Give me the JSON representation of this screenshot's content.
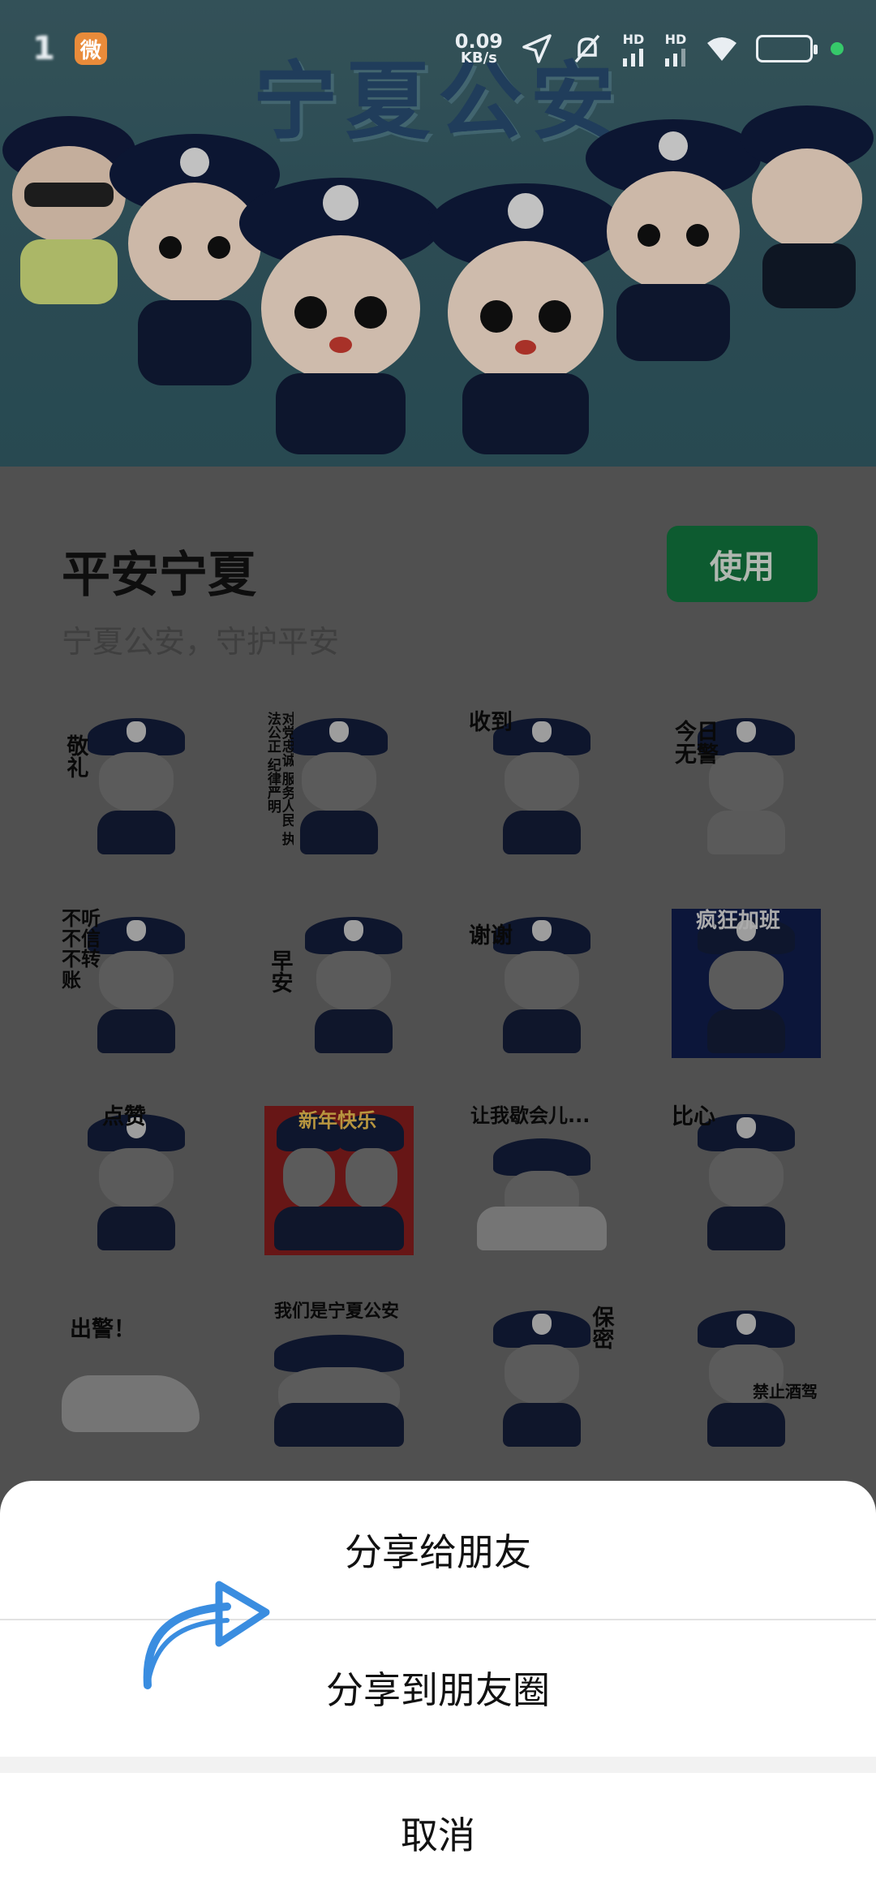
{
  "status_bar": {
    "time": "1",
    "net_speed_value": "0.09",
    "net_speed_unit": "KB/s",
    "hd1": "HD",
    "hd2": "HD",
    "app_notif_icon": "weibo-icon"
  },
  "banner": {
    "title": "宁夏公安",
    "colors": {
      "background": "#355a63",
      "title": "#26486b"
    }
  },
  "pack": {
    "title": "平安宁夏",
    "subtitle": "宁夏公安，守护平安",
    "use_button": "使用",
    "accent": "#106c39",
    "stickers": [
      {
        "caption": "敬礼"
      },
      {
        "caption": "对党忠诚 服务人民 执法公正 纪律严明"
      },
      {
        "caption": "收到"
      },
      {
        "caption": "今日无警"
      },
      {
        "caption": "不听 不信 不转账"
      },
      {
        "caption": "早安"
      },
      {
        "caption": "谢谢"
      },
      {
        "caption": "疯狂加班"
      },
      {
        "caption": "点赞"
      },
      {
        "caption": "新年快乐"
      },
      {
        "caption": "让我歇会儿..."
      },
      {
        "caption": "比心"
      },
      {
        "caption": "出警！"
      },
      {
        "caption": "我们是宁夏公安"
      },
      {
        "caption": "保密"
      },
      {
        "caption": "禁止酒驾"
      }
    ]
  },
  "share_sheet": {
    "share_friend": "分享给朋友",
    "share_moments": "分享到朋友圈",
    "cancel": "取消"
  }
}
